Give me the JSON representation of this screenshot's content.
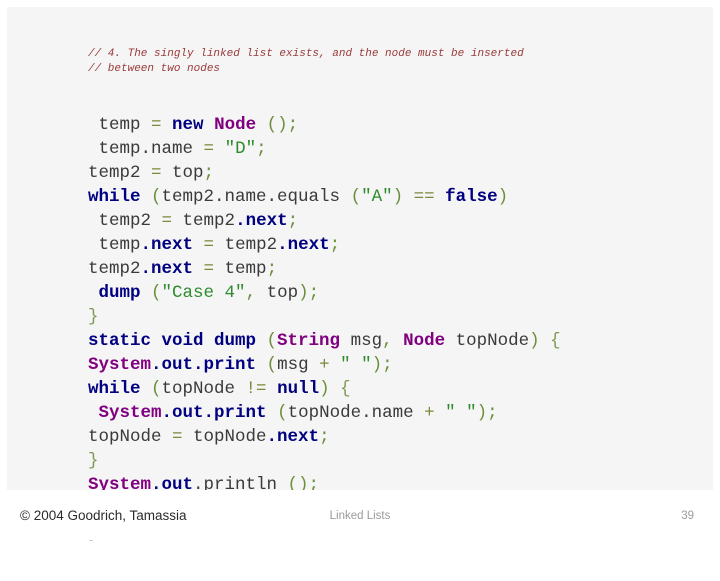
{
  "slide": {
    "background_color": "#ffffff",
    "panel_color": "#f5f5f5"
  },
  "syntax_colors": {
    "comment": "#9a3b3b",
    "keyword": "#000080",
    "type": "#800080",
    "string": "#2e8b2e",
    "punctuation": "#6b8f3a",
    "operator": "#7a8a3a",
    "identifier": "#3a3a3a",
    "brace": "#7f9a52"
  },
  "code": {
    "language": "java",
    "comments": [
      "// 4. The singly linked list exists, and the node must be inserted",
      "// between two nodes"
    ],
    "lines": [
      {
        "indent": " ",
        "tokens": [
          {
            "t": "temp ",
            "c": "id"
          },
          {
            "t": "= ",
            "c": "op"
          },
          {
            "t": "new ",
            "c": "kw"
          },
          {
            "t": "Node ",
            "c": "type"
          },
          {
            "t": "();",
            "c": "punc"
          }
        ]
      },
      {
        "indent": " ",
        "tokens": [
          {
            "t": "temp.name ",
            "c": "id"
          },
          {
            "t": "= ",
            "c": "op"
          },
          {
            "t": "\"D\"",
            "c": "str"
          },
          {
            "t": ";",
            "c": "punc"
          }
        ]
      },
      {
        "indent": "",
        "tokens": [
          {
            "t": "temp2 ",
            "c": "id"
          },
          {
            "t": "= ",
            "c": "op"
          },
          {
            "t": "top",
            "c": "id"
          },
          {
            "t": ";",
            "c": "punc"
          }
        ]
      },
      {
        "indent": "",
        "tokens": [
          {
            "t": "while ",
            "c": "kw"
          },
          {
            "t": "(",
            "c": "punc"
          },
          {
            "t": "temp2.name.equals ",
            "c": "id"
          },
          {
            "t": "(",
            "c": "punc"
          },
          {
            "t": "\"A\"",
            "c": "str"
          },
          {
            "t": ") ",
            "c": "punc"
          },
          {
            "t": "== ",
            "c": "op"
          },
          {
            "t": "false",
            "c": "kw"
          },
          {
            "t": ")",
            "c": "punc"
          }
        ]
      },
      {
        "indent": " ",
        "tokens": [
          {
            "t": "temp2 ",
            "c": "id"
          },
          {
            "t": "= ",
            "c": "op"
          },
          {
            "t": "temp2",
            "c": "id"
          },
          {
            "t": ".next",
            "c": "kw"
          },
          {
            "t": ";",
            "c": "punc"
          }
        ]
      },
      {
        "indent": " ",
        "tokens": [
          {
            "t": "temp",
            "c": "id"
          },
          {
            "t": ".next ",
            "c": "kw"
          },
          {
            "t": "= ",
            "c": "op"
          },
          {
            "t": "temp2",
            "c": "id"
          },
          {
            "t": ".next",
            "c": "kw"
          },
          {
            "t": ";",
            "c": "punc"
          }
        ]
      },
      {
        "indent": "",
        "tokens": [
          {
            "t": "temp2",
            "c": "id"
          },
          {
            "t": ".next ",
            "c": "kw"
          },
          {
            "t": "= ",
            "c": "op"
          },
          {
            "t": "temp",
            "c": "id"
          },
          {
            "t": ";",
            "c": "punc"
          }
        ]
      },
      {
        "indent": " ",
        "tokens": [
          {
            "t": "dump ",
            "c": "kw"
          },
          {
            "t": "(",
            "c": "punc"
          },
          {
            "t": "\"Case 4\"",
            "c": "str"
          },
          {
            "t": ", ",
            "c": "punc"
          },
          {
            "t": "top",
            "c": "id"
          },
          {
            "t": ");",
            "c": "punc"
          }
        ]
      },
      {
        "indent": "",
        "tokens": [
          {
            "t": "}",
            "c": "brace"
          }
        ]
      },
      {
        "indent": "",
        "tokens": [
          {
            "t": "static void dump ",
            "c": "kw"
          },
          {
            "t": "(",
            "c": "punc"
          },
          {
            "t": "String ",
            "c": "type"
          },
          {
            "t": "msg",
            "c": "id"
          },
          {
            "t": ", ",
            "c": "punc"
          },
          {
            "t": "Node ",
            "c": "type"
          },
          {
            "t": "topNode",
            "c": "id"
          },
          {
            "t": ") ",
            "c": "punc"
          },
          {
            "t": "{",
            "c": "brace"
          }
        ]
      },
      {
        "indent": "",
        "tokens": [
          {
            "t": "System",
            "c": "type"
          },
          {
            "t": ".out.print ",
            "c": "kw"
          },
          {
            "t": "(",
            "c": "punc"
          },
          {
            "t": "msg ",
            "c": "id"
          },
          {
            "t": "+ ",
            "c": "op"
          },
          {
            "t": "\" \"",
            "c": "str"
          },
          {
            "t": ");",
            "c": "punc"
          }
        ]
      },
      {
        "indent": "",
        "tokens": [
          {
            "t": "while ",
            "c": "kw"
          },
          {
            "t": "(",
            "c": "punc"
          },
          {
            "t": "topNode ",
            "c": "id"
          },
          {
            "t": "!= ",
            "c": "op"
          },
          {
            "t": "null",
            "c": "kw"
          },
          {
            "t": ") ",
            "c": "punc"
          },
          {
            "t": "{",
            "c": "brace"
          }
        ]
      },
      {
        "indent": " ",
        "tokens": [
          {
            "t": "System",
            "c": "type"
          },
          {
            "t": ".out.print ",
            "c": "kw"
          },
          {
            "t": "(",
            "c": "punc"
          },
          {
            "t": "topNode.name ",
            "c": "id"
          },
          {
            "t": "+ ",
            "c": "op"
          },
          {
            "t": "\" \"",
            "c": "str"
          },
          {
            "t": ");",
            "c": "punc"
          }
        ]
      },
      {
        "indent": "",
        "tokens": [
          {
            "t": "topNode ",
            "c": "id"
          },
          {
            "t": "= ",
            "c": "op"
          },
          {
            "t": "topNode",
            "c": "id"
          },
          {
            "t": ".next",
            "c": "kw"
          },
          {
            "t": ";",
            "c": "punc"
          }
        ]
      },
      {
        "indent": "",
        "tokens": [
          {
            "t": "}",
            "c": "brace"
          }
        ]
      },
      {
        "indent": "",
        "tokens": [
          {
            "t": "System",
            "c": "type"
          },
          {
            "t": ".out",
            "c": "kw"
          },
          {
            "t": ".println ",
            "c": "id"
          },
          {
            "t": "();",
            "c": "punc"
          }
        ]
      },
      {
        "indent": "",
        "tokens": [
          {
            "t": "}",
            "c": "brace"
          }
        ]
      },
      {
        "indent": "",
        "tokens": [
          {
            "t": "}",
            "c": "brace"
          }
        ]
      }
    ]
  },
  "footer": {
    "copyright": "© 2004 Goodrich, Tamassia",
    "title": "Linked Lists",
    "page_number": "39"
  }
}
